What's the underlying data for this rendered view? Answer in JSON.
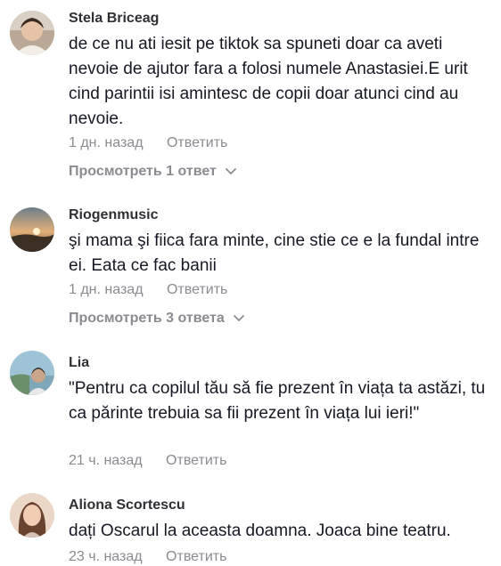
{
  "comments": [
    {
      "username": "Stela Briceag",
      "text": "de ce nu ati iesit pe tiktok sa spuneti doar ca aveti nevoie de ajutor fara a folosi numele Anastasiei.E urit cind parintii isi amintesc de copii doar atunci cind au nevoie.",
      "time": "1 дн. назад",
      "reply_label": "Ответить",
      "view_replies_label": "Просмотреть 1 ответ"
    },
    {
      "username": "Riogenmusic",
      "text": "şi mama şi fiica fara minte, cine stie ce e la fundal intre ei. Eata ce fac banii",
      "time": "1 дн. назад",
      "reply_label": "Ответить",
      "view_replies_label": "Просмотреть 3 ответа"
    },
    {
      "username": "Lia",
      "text": "\"Pentru ca copilul tău să fie prezent în viața ta astăzi, tu ca părinte trebuia sa fii prezent în viața lui ieri!\"",
      "time": "21 ч. назад",
      "reply_label": "Ответить"
    },
    {
      "username": "Aliona Scortescu",
      "text": "dați Oscarul la aceasta doamna. Joaca bine teatru.",
      "time": "23 ч. назад",
      "reply_label": "Ответить"
    }
  ],
  "icons": {
    "chevron": "chevron-down-icon"
  }
}
